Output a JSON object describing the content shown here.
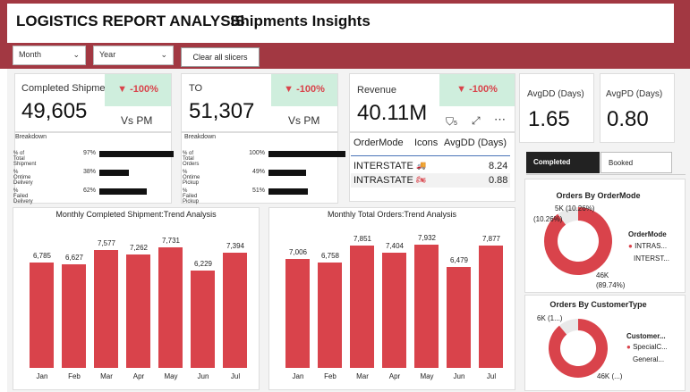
{
  "header": {
    "title": "LOGISTICS REPORT ANALYSIS",
    "subtitle": "Shipments Insights"
  },
  "slicers": {
    "month": "Month",
    "year": "Year",
    "clear": "Clear all slicers"
  },
  "kpi_completed": {
    "label": "Completed Shipment",
    "value": "49,605",
    "change": "-100%",
    "vs": "Vs PM",
    "breakdown_title": "Breakdown",
    "rows": [
      {
        "label": "% of Total Shipment",
        "pct": "97%",
        "fill": 0.97
      },
      {
        "label": "% Ontime Delivery",
        "pct": "38%",
        "fill": 0.38
      },
      {
        "label": "% Failed Delivery",
        "pct": "62%",
        "fill": 0.62
      }
    ]
  },
  "kpi_to": {
    "label": "TO",
    "value": "51,307",
    "change": "-100%",
    "vs": "Vs PM",
    "breakdown_title": "Breakdown",
    "rows": [
      {
        "label": "% of Total Orders",
        "pct": "100%",
        "fill": 1.0
      },
      {
        "label": "% Ontime Pickup",
        "pct": "49%",
        "fill": 0.49
      },
      {
        "label": "% Failed Pickup",
        "pct": "51%",
        "fill": 0.51
      }
    ]
  },
  "kpi_revenue": {
    "label": "Revenue",
    "value": "40.11M",
    "change": "-100%",
    "filter_count": "5"
  },
  "ordermode_table": {
    "headers": [
      "OrderMode",
      "Icons",
      "AvgDD (Days)"
    ],
    "rows": [
      {
        "mode": "INTERSTATE",
        "icon": "truck-icon",
        "avg": "8.24"
      },
      {
        "mode": "INTRASTATE",
        "icon": "motorbike-icon",
        "avg": "0.88"
      }
    ]
  },
  "avgdd": {
    "label": "AvgDD (Days)",
    "value": "1.65"
  },
  "avgpd": {
    "label": "AvgPD (Days)",
    "value": "0.80"
  },
  "tabs": {
    "completed": "Completed",
    "booked": "Booked"
  },
  "colors": {
    "accent": "#d9434b",
    "banner": "#a23842",
    "badge_bg": "#cfeedd"
  },
  "chart_data": [
    {
      "type": "bar",
      "title": "Monthly Completed Shipment:Trend Analysis",
      "categories": [
        "Jan",
        "Feb",
        "Mar",
        "Apr",
        "May",
        "Jun",
        "Jul"
      ],
      "values": [
        6785,
        6627,
        7577,
        7262,
        7731,
        6229,
        7394
      ],
      "labels": [
        "6,785",
        "6,627",
        "7,577",
        "7,262",
        "7,731",
        "6,229",
        "7,394"
      ],
      "ylim": [
        0,
        8600
      ]
    },
    {
      "type": "bar",
      "title": "Monthly Total Orders:Trend Analysis",
      "categories": [
        "Jan",
        "Feb",
        "Mar",
        "Apr",
        "May",
        "Jun",
        "Jul"
      ],
      "values": [
        7006,
        6758,
        7851,
        7404,
        7932,
        6479,
        7877
      ],
      "labels": [
        "7,006",
        "6,758",
        "7,851",
        "7,404",
        "7,932",
        "6,479",
        "7,877"
      ],
      "ylim": [
        0,
        8600
      ]
    },
    {
      "type": "pie",
      "title": "Orders By OrderMode",
      "legend_title": "OrderMode",
      "legend": [
        "INTRAS...",
        "INTERST..."
      ],
      "slices": [
        {
          "label": "46K\n(89.74%)",
          "value": 89.74
        },
        {
          "label": "5K\n(10.26%)",
          "value": 10.26
        }
      ]
    },
    {
      "type": "pie",
      "title": "Orders By CustomerType",
      "legend_title": "Customer...",
      "legend": [
        "SpecialC...",
        "General..."
      ],
      "slices": [
        {
          "label": "46K (...)",
          "value": 89.0
        },
        {
          "label": "6K (1...)",
          "value": 11.0
        }
      ]
    }
  ]
}
